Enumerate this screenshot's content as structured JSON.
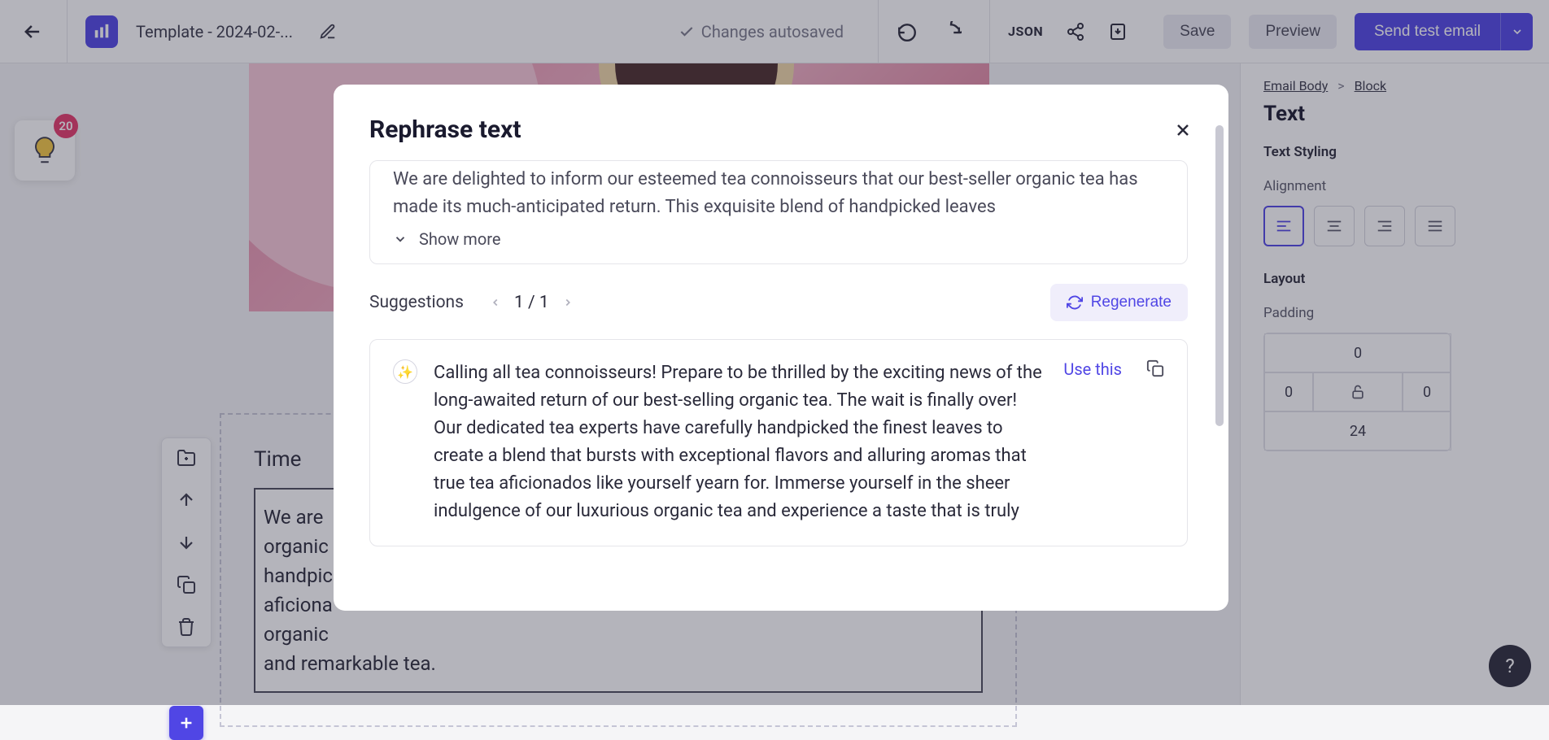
{
  "topbar": {
    "title": "Template - 2024-02-...",
    "autosave": "Changes autosaved",
    "json": "JSON",
    "save": "Save",
    "preview": "Preview",
    "send": "Send test email"
  },
  "bulb_count": "20",
  "content": {
    "heading": "Time",
    "body_line1": "We are",
    "body_line2": "organic",
    "body_line3": "handpic",
    "body_line4": "aficiona",
    "body_line5": "organic",
    "body_line6": "and remarkable tea."
  },
  "side": {
    "crumb1": "Email Body",
    "crumb2": "Block",
    "crumb_sep": ">",
    "title": "Text",
    "styling": "Text Styling",
    "alignment": "Alignment",
    "layout": "Layout",
    "padding": "Padding",
    "pad_top": "0",
    "pad_left": "0",
    "pad_right": "0",
    "pad_bottom": "24"
  },
  "modal": {
    "title": "Rephrase text",
    "original": "We are delighted to inform our esteemed tea connoisseurs that our best-seller organic tea has made its much-anticipated return. This exquisite blend of handpicked leaves",
    "show_more": "Show more",
    "suggestions_label": "Suggestions",
    "pager": "1 / 1",
    "regenerate": "Regenerate",
    "suggestion_text": "Calling all tea connoisseurs! Prepare to be thrilled by the exciting news of the long-awaited return of our best-selling organic tea. The wait is finally over! Our dedicated tea experts have carefully handpicked the finest leaves to create a blend that bursts with exceptional flavors and alluring aromas that true tea aficionados like yourself yearn for. Immerse yourself in the sheer indulgence of our luxurious organic tea and experience a taste that is truly",
    "use_this": "Use this"
  },
  "help": "?"
}
